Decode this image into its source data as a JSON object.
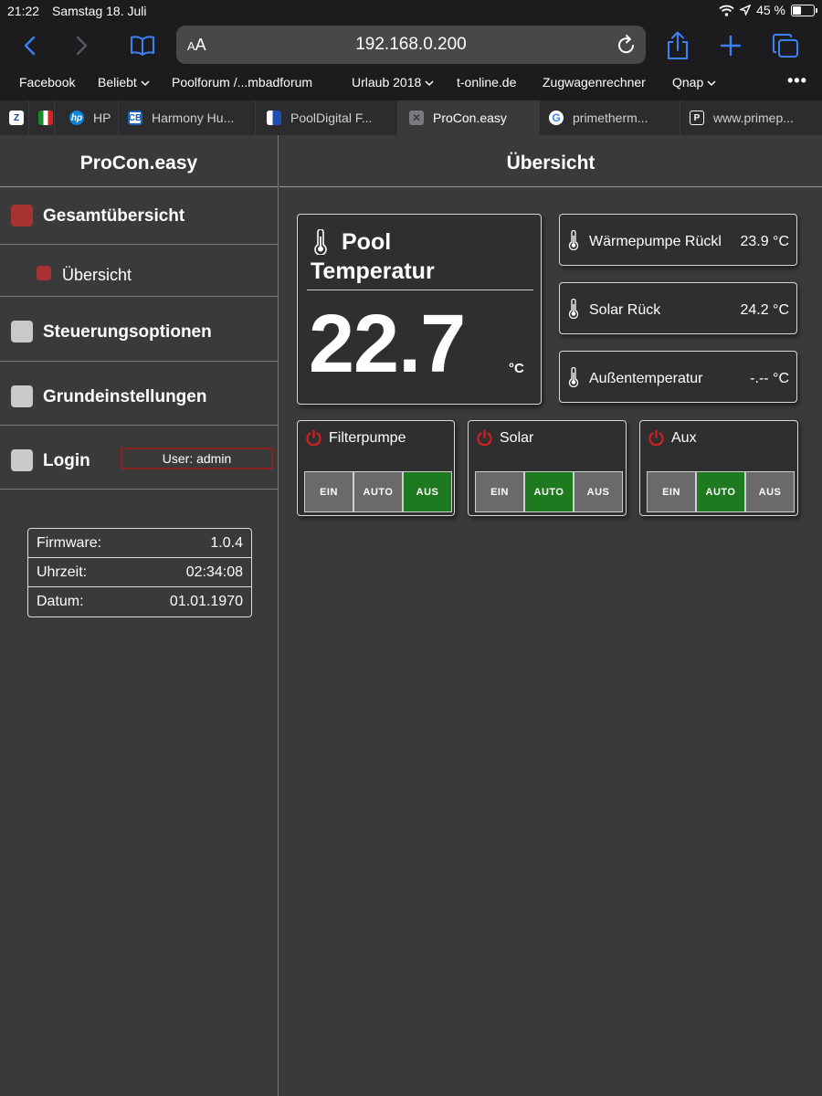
{
  "status": {
    "time": "21:22",
    "date": "Samstag 18. Juli",
    "battery": "45 %"
  },
  "browser": {
    "url": "192.168.0.200",
    "aa": "AA",
    "bookmarks": [
      "Facebook",
      "Beliebt",
      "Poolforum /...mbadforum",
      "Urlaub 2018",
      "t-online.de",
      "Zugwagenrechner",
      "Qnap"
    ],
    "tabs": [
      {
        "label": ""
      },
      {
        "label": ""
      },
      {
        "label": "HP"
      },
      {
        "label": "Harmony Hu..."
      },
      {
        "label": "PoolDigital F..."
      },
      {
        "label": "ProCon.easy"
      },
      {
        "label": "primetherm..."
      },
      {
        "label": "www.primep..."
      }
    ]
  },
  "sidebar": {
    "title": "ProCon.easy",
    "items": [
      {
        "label": "Gesamtübersicht"
      },
      {
        "label": "Übersicht"
      },
      {
        "label": "Steuerungsoptionen"
      },
      {
        "label": "Grundeinstellungen"
      },
      {
        "label": "Login"
      }
    ],
    "user": "User: admin",
    "info": [
      {
        "label": "Firmware:",
        "value": "1.0.4"
      },
      {
        "label": "Uhrzeit:",
        "value": "02:34:08"
      },
      {
        "label": "Datum:",
        "value": "01.01.1970"
      }
    ]
  },
  "main": {
    "title": "Übersicht",
    "pool": {
      "line1": "Pool",
      "line2": "Temperatur",
      "value": "22.7",
      "unit": "°C"
    },
    "sensors": [
      {
        "name": "Wärmepumpe Rückl",
        "value": "23.9 °C"
      },
      {
        "name": "Solar Rück",
        "value": "24.2 °C"
      },
      {
        "name": "Außentemperatur",
        "value": "-.-- °C"
      }
    ],
    "controls": [
      {
        "title": "Filterpumpe",
        "active": "AUS"
      },
      {
        "title": "Solar",
        "active": "AUTO"
      },
      {
        "title": "Aux",
        "active": "AUTO"
      }
    ],
    "button_labels": {
      "ein": "EIN",
      "auto": "AUTO",
      "aus": "AUS"
    }
  },
  "colors": {
    "accent_red": "#a83232",
    "active_green": "#1e7a1e",
    "background": "#3a3a3a",
    "ios_blue": "#3b82f6"
  }
}
